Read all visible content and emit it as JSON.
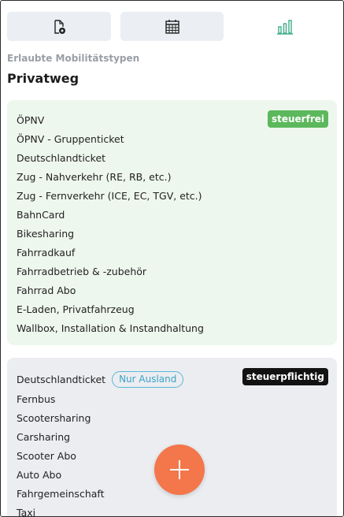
{
  "tabs": [
    {
      "icon": "document-gear-icon",
      "active": false
    },
    {
      "icon": "calendar-icon",
      "active": false
    },
    {
      "icon": "bar-chart-icon",
      "active": true
    }
  ],
  "section": {
    "label": "Erlaubte Mobilitätstypen",
    "title": "Privatweg"
  },
  "free_card": {
    "badge": "steuerfrei",
    "items": [
      "ÖPNV",
      "ÖPNV - Gruppenticket",
      "Deutschlandticket",
      "Zug - Nahverkehr (RE, RB, etc.)",
      "Zug - Fernverkehr (ICE, EC, TGV, etc.)",
      "BahnCard",
      "Bikesharing",
      "Fahrradkauf",
      "Fahrradbetrieb & -zubehör",
      "Fahrrad Abo",
      "E-Laden, Privatfahrzeug",
      "Wallbox, Installation & Instandhaltung"
    ]
  },
  "taxed_card": {
    "badge": "steuerpflichtig",
    "first_item_tag": "Nur Ausland",
    "items": [
      "Deutschlandticket",
      "Fernbus",
      "Scootersharing",
      "Carsharing",
      "Scooter Abo",
      "Auto Abo",
      "Fahrgemeinschaft",
      "Taxi"
    ]
  },
  "fab": {
    "icon": "plus-icon"
  },
  "colors": {
    "accent_green": "#5cb85c",
    "tab_active_green": "#3dae8a",
    "fab_orange": "#f4764b",
    "pill_blue": "#3aa3c9"
  }
}
